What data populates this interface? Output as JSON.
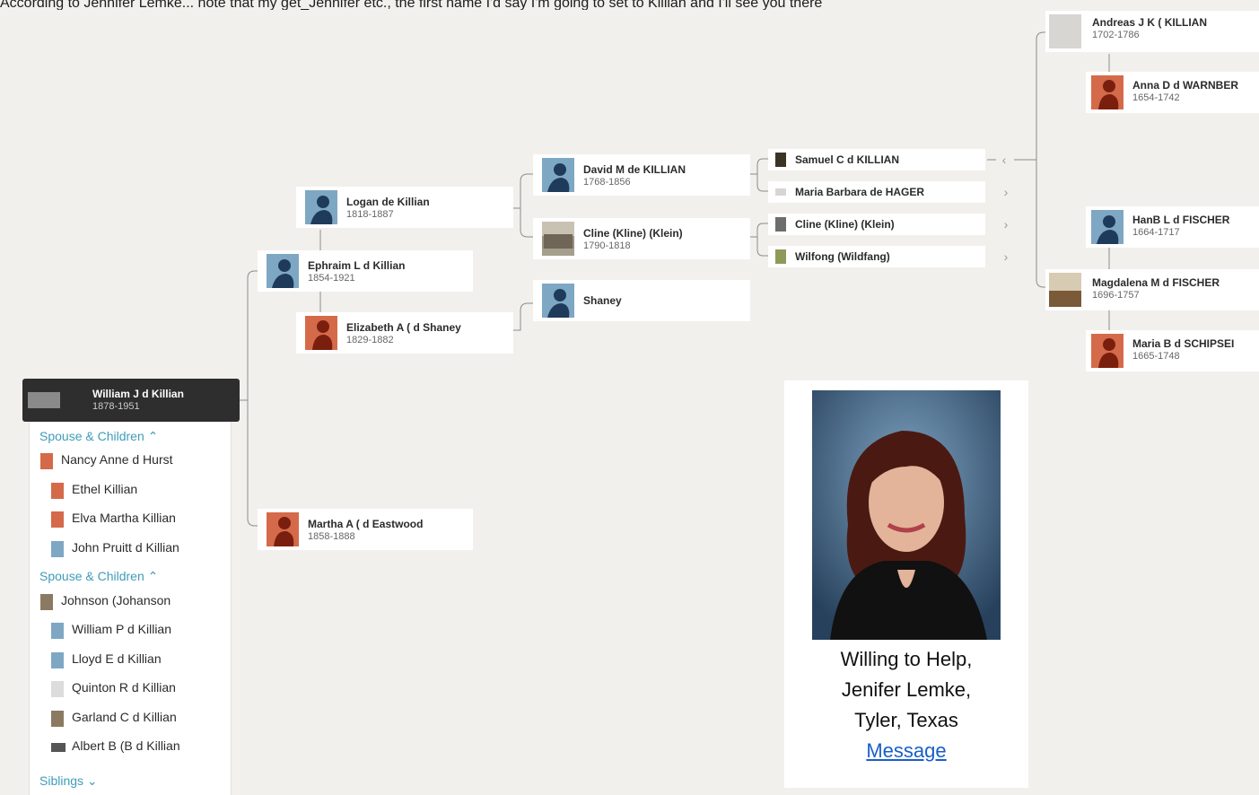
{
  "top_text": "According to Jennifer Lemke... note that my get_Jennifer etc., the first name I'd say I'm going to set to Killian and I'll see you there",
  "root": {
    "name": "William J d Killian",
    "dates": "1878-1951"
  },
  "family": {
    "spouse_heading_1": "Spouse & Children",
    "spouse_1": "Nancy Anne d Hurst",
    "children_1": [
      "Ethel Killian",
      "Elva Martha Killian",
      "John Pruitt d Killian"
    ],
    "spouse_heading_2": "Spouse & Children",
    "spouse_2": "Johnson (Johanson",
    "children_2": [
      "William P d Killian",
      "Lloyd E d Killian",
      "Quinton R d Killian",
      "Garland C d Killian",
      "Albert B (B d Killian"
    ],
    "siblings_heading": "Siblings"
  },
  "gen1": {
    "father": {
      "name": "Ephraim L d Killian",
      "dates": "1854-1921"
    },
    "mother": {
      "name": "Martha A ( d Eastwood",
      "dates": "1858-1888"
    }
  },
  "gen2": {
    "father": {
      "name": "Logan de Killian",
      "dates": "1818-1887"
    },
    "mother": {
      "name": "Elizabeth A ( d Shaney",
      "dates": "1829-1882"
    }
  },
  "gen3": {
    "p1": {
      "name": "David M de KILLIAN",
      "dates": "1768-1856"
    },
    "p2": {
      "name": "Cline (Kline) (Klein)",
      "dates": "1790-1818"
    },
    "p3": {
      "name": "Shaney"
    }
  },
  "gen4": {
    "p1": {
      "name": "Samuel C d KILLIAN"
    },
    "p2": {
      "name": "Maria Barbara de HAGER"
    },
    "p3": {
      "name": "Cline (Kline) (Klein)"
    },
    "p4": {
      "name": "Wilfong (Wildfang)"
    }
  },
  "gen5": {
    "p1": {
      "name": "Andreas J K ( KILLIAN",
      "dates": "1702-1786"
    },
    "p2": {
      "name": "Anna D d WARNBER",
      "dates": "1654-1742"
    },
    "p3": {
      "name": "HanB L d FISCHER",
      "dates": "1664-1717"
    },
    "p4": {
      "name": "Magdalena M d FISCHER",
      "dates": "1696-1757"
    },
    "p5": {
      "name": "Maria B d SCHIPSEI",
      "dates": "1665-1748"
    }
  },
  "helper": {
    "line1": "Willing to Help,",
    "line2": "Jenifer Lemke,",
    "line3": "Tyler, Texas",
    "link": "Message"
  },
  "icons": {
    "male_avatar": "male-silhouette-icon",
    "female_avatar": "female-silhouette-icon",
    "chevron_left": "chevron-left-icon",
    "chevron_right": "chevron-right-icon",
    "chevron_up": "chevron-up-icon",
    "chevron_down": "chevron-down-icon"
  },
  "colors": {
    "accent": "#3f9cb8",
    "male": "#7ea7c4",
    "female": "#d46a4a",
    "root_bg": "#2e2e2e"
  }
}
